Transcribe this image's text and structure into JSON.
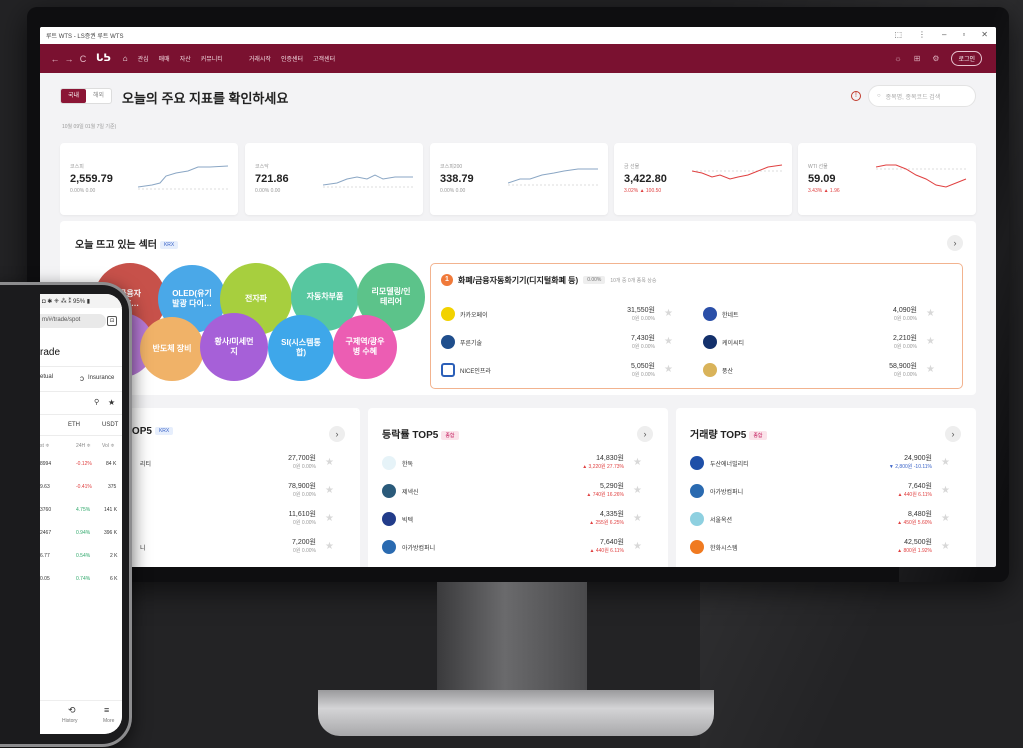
{
  "window": {
    "title": "루트 WTS - LS증권 루트 WTS",
    "controls": [
      "⬚",
      "⋮",
      "–",
      "▫",
      "✕"
    ]
  },
  "nav": {
    "back": "←",
    "forward": "→",
    "refresh": "C",
    "logo": "ᒐᕊ",
    "home_icon": "⌂",
    "items": [
      "관심",
      "매매",
      "자산",
      "커뮤니티"
    ],
    "items2": [
      "거래시작",
      "인증센터",
      "고객센터"
    ],
    "right_icons": [
      "☼",
      "⊞",
      "⚙"
    ],
    "login": "로그인"
  },
  "header": {
    "toggle_domestic": "국내",
    "toggle_overseas": "해외",
    "title": "오늘의 주요 지표를 확인하세요",
    "date": "10월 09일 01월 7일 기준)",
    "info_icon": "!",
    "search_placeholder": "종목명, 종목코드 검색"
  },
  "indices": [
    {
      "name": "코스피",
      "value": "2,559.79",
      "change": "0.00%  0.00",
      "dir": "flat"
    },
    {
      "name": "코스닥",
      "value": "721.86",
      "change": "0.00%  0.00",
      "dir": "flat"
    },
    {
      "name": "코스피200",
      "value": "338.79",
      "change": "0.00%  0.00",
      "dir": "flat"
    },
    {
      "name": "금 선물",
      "value": "3,422.80",
      "change": "3.02%  ▲ 100.50",
      "dir": "up"
    },
    {
      "name": "WTI 선물",
      "value": "59.09",
      "change": "3.43%  ▲ 1.96",
      "dir": "up"
    }
  ],
  "sector": {
    "title": "오늘 뜨고 있는 섹터",
    "badge": "KRX",
    "next": "›",
    "bubbles": [
      {
        "label": "금융자\n기(…",
        "color": "#c7514a"
      },
      {
        "label": "OLED(유기\n발광 다이…",
        "color": "#4aa8e8"
      },
      {
        "label": "전자파",
        "color": "#a7cf3e"
      },
      {
        "label": "자동차부품",
        "color": "#57c7a0"
      },
      {
        "label": "리모델링/인\n테리어",
        "color": "#5cc38a"
      },
      {
        "label": "료/",
        "color": "#b77ad6"
      },
      {
        "label": "반도체 장비",
        "color": "#f0b268"
      },
      {
        "label": "황사/미세먼\n지",
        "color": "#a660d8"
      },
      {
        "label": "SI(시스템통\n합)",
        "color": "#3ea7ea"
      },
      {
        "label": "구제역/광우\n병 수혜",
        "color": "#ec5db3"
      }
    ],
    "detail": {
      "rank": "1",
      "name": "화폐/금융자동화기기(디지털화폐 등)",
      "pct": "0.00%",
      "sub": "10개 중 0개 종목 상승",
      "items": [
        {
          "name": "카카오페이",
          "price": "31,550원",
          "change": "0원  0.00%",
          "color": "#f2d200"
        },
        {
          "name": "한네트",
          "price": "4,090원",
          "change": "0원  0.00%",
          "color": "#2a4fa8"
        },
        {
          "name": "푸른기술",
          "price": "7,430원",
          "change": "0원  0.00%",
          "color": "#1f4e8c"
        },
        {
          "name": "케이씨티",
          "price": "2,210원",
          "change": "0원  0.00%",
          "color": "#13306b"
        },
        {
          "name": "NICE인프라",
          "price": "5,050원",
          "change": "0원  0.00%",
          "color": "#2b5fb8"
        },
        {
          "name": "풍산",
          "price": "58,900원",
          "change": "0원  0.00%",
          "color": "#d9b35a"
        }
      ]
    }
  },
  "top5": [
    {
      "title": "TOP5",
      "badge": "KRX",
      "rows": [
        {
          "name": "리티",
          "price": "27,700원",
          "change": "0원  0.00%",
          "dir": "flat",
          "color": "#ffffff"
        },
        {
          "name": "",
          "price": "78,900원",
          "change": "0원  0.00%",
          "dir": "flat",
          "color": "#ffffff"
        },
        {
          "name": "",
          "price": "11,610원",
          "change": "0원  0.00%",
          "dir": "flat",
          "color": "#ffffff"
        },
        {
          "name": "니",
          "price": "7,200원",
          "change": "0원  0.00%",
          "dir": "flat",
          "color": "#ffffff"
        }
      ]
    },
    {
      "title": "등락률 TOP5",
      "badge": "종합",
      "rows": [
        {
          "name": "한독",
          "price": "14,830원",
          "change": "▲ 3,220원  27.73%",
          "dir": "up",
          "color": "#4aa3c8"
        },
        {
          "name": "제넥신",
          "price": "5,290원",
          "change": "▲ 740원  16.26%",
          "dir": "up",
          "color": "#2a5a7a"
        },
        {
          "name": "빅텍",
          "price": "4,335원",
          "change": "▲ 255원  6.25%",
          "dir": "up",
          "color": "#223c8a"
        },
        {
          "name": "아가방컴퍼니",
          "price": "7,640원",
          "change": "▲ 440원  6.11%",
          "dir": "up",
          "color": "#2a6ab0"
        }
      ]
    },
    {
      "title": "거래량 TOP5",
      "badge": "종합",
      "rows": [
        {
          "name": "두산에너빌리티",
          "price": "24,900원",
          "change": "▼ 2,800원  -10.11%",
          "dir": "dn",
          "color": "#1e4fa8"
        },
        {
          "name": "아가방컴퍼니",
          "price": "7,640원",
          "change": "▲ 440원  6.11%",
          "dir": "up",
          "color": "#2a6ab0"
        },
        {
          "name": "서울옥션",
          "price": "8,480원",
          "change": "▲ 450원  5.60%",
          "dir": "up",
          "color": "#8ed0e0"
        },
        {
          "name": "한화시스템",
          "price": "42,500원",
          "change": "▲ 800원  1.92%",
          "dir": "up",
          "color": "#f07a20"
        }
      ]
    }
  ],
  "phone": {
    "status": "◘ ✱ ⁜ ⁂ ⁑ 95% ▮",
    "url": "m/#/trade/spot",
    "tabs_count": "⊡",
    "menu": "⋮",
    "title": "rade",
    "tab_perpetual": "etual",
    "tab_insurance": "Insurance",
    "search_icon": "🔍",
    "star_icon": "★",
    "currencies": [
      "ETH",
      "USDT"
    ],
    "headers": [
      "st ≑",
      "24H ≑",
      "Vol ≑"
    ],
    "rows": [
      {
        "price": "8994",
        "pct": "-0.12%",
        "vol": "84 K",
        "dir": "dn"
      },
      {
        "price": "9.63",
        "pct": "-0.41%",
        "vol": "375",
        "dir": "dn"
      },
      {
        "price": "3760",
        "pct": "4.75%",
        "vol": "141 K",
        "dir": "up"
      },
      {
        "price": "2467",
        "pct": "0.94%",
        "vol": "396 K",
        "dir": "up"
      },
      {
        "price": "6.77",
        "pct": "0.54%",
        "vol": "2 K",
        "dir": "up"
      },
      {
        "price": "0.05",
        "pct": "0.74%",
        "vol": "6 K",
        "dir": "up"
      }
    ],
    "nav_history": "History",
    "nav_more": "More",
    "history_icon": "⟲",
    "more_icon": "≡"
  },
  "colors": {
    "brand": "#7a1130",
    "up": "#e04040",
    "down": "#3a63c8"
  }
}
